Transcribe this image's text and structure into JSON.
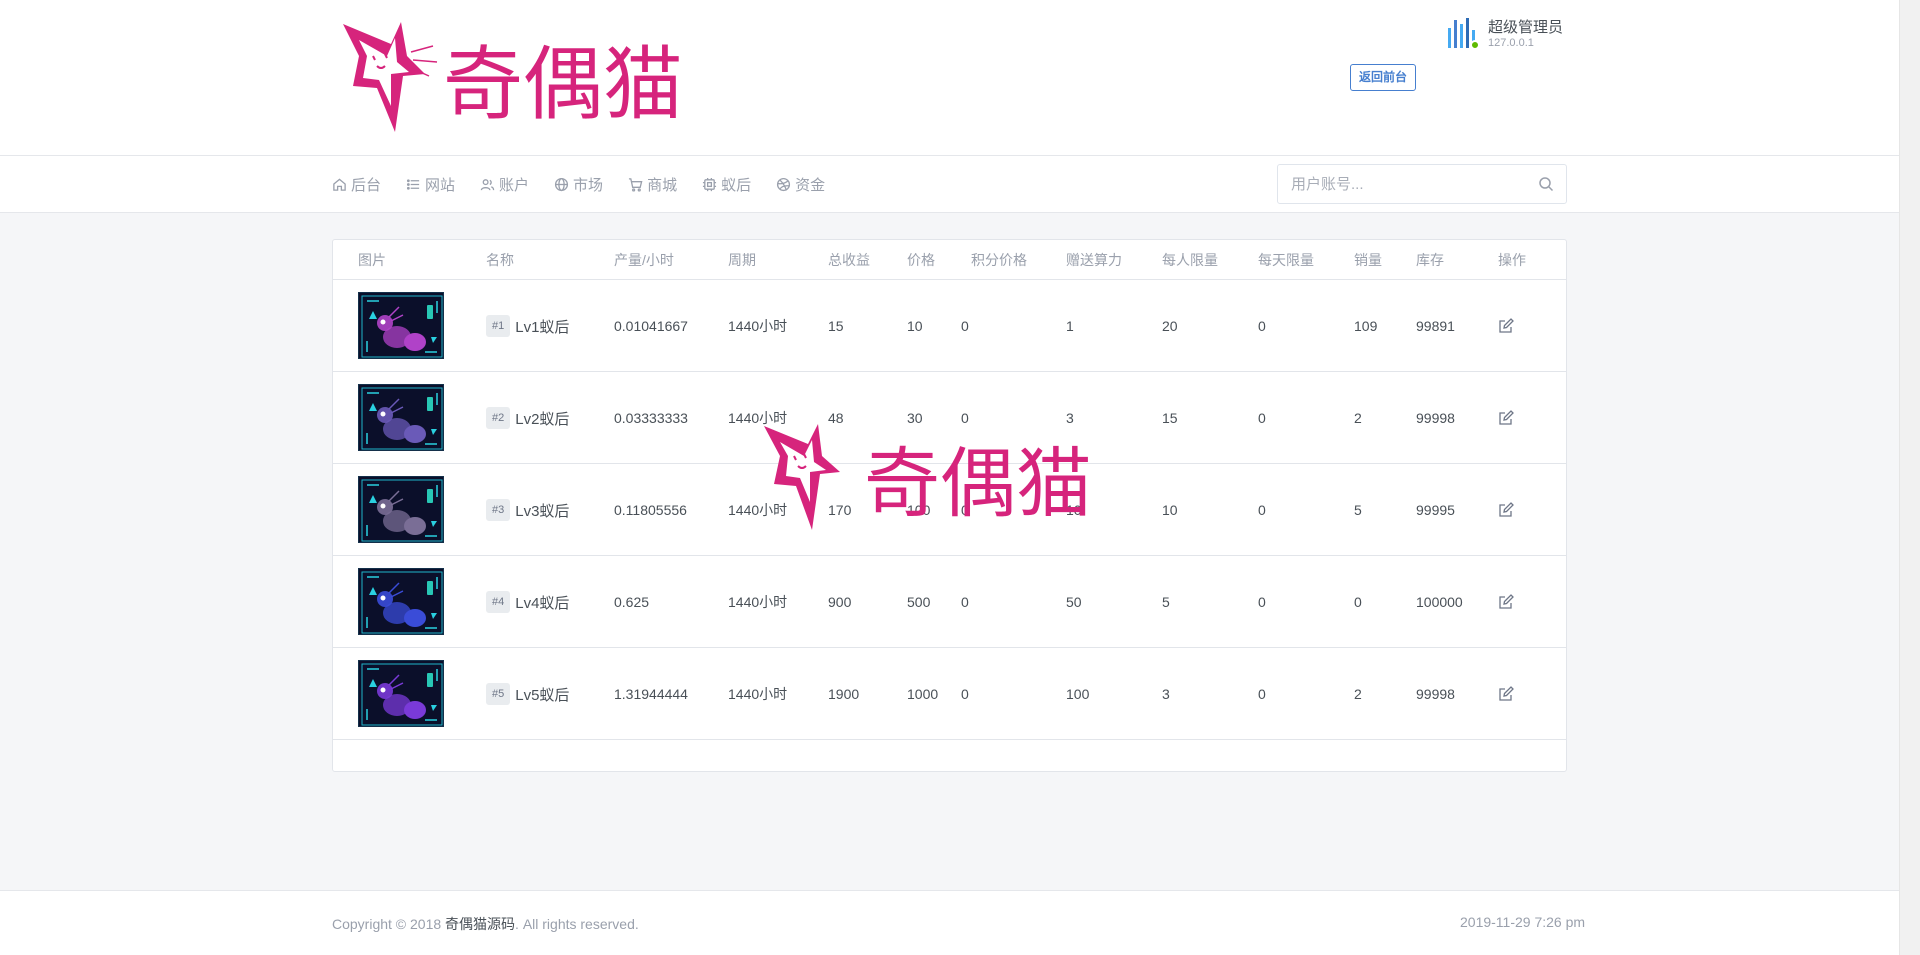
{
  "brand": {
    "logo_text": "奇偶猫",
    "primary_color": "#d6247c"
  },
  "user": {
    "name": "超级管理员",
    "ip": "127.0.0.1",
    "status_color": "#5eba00",
    "avatar_icon": "bar-chart-avatar-icon"
  },
  "header": {
    "back_button": "返回前台"
  },
  "nav": {
    "items": [
      {
        "label": "后台",
        "icon": "home-icon"
      },
      {
        "label": "网站",
        "icon": "list-icon"
      },
      {
        "label": "账户",
        "icon": "users-icon"
      },
      {
        "label": "市场",
        "icon": "globe-icon"
      },
      {
        "label": "商城",
        "icon": "cart-icon"
      },
      {
        "label": "蚁后",
        "icon": "cpu-icon"
      },
      {
        "label": "资金",
        "icon": "dribbble-icon"
      }
    ],
    "search_placeholder": "用户账号..."
  },
  "table": {
    "columns": [
      "图片",
      "名称",
      "产量/小时",
      "周期",
      "总收益",
      "价格",
      "积分价格",
      "赠送算力",
      "每人限量",
      "每天限量",
      "销量",
      "库存",
      "操作"
    ],
    "rows": [
      {
        "id": "#1",
        "name": "Lv1蚁后",
        "output": "0.01041667",
        "period": "1440小时",
        "total": "15",
        "price": "10",
        "points_price": "0",
        "bonus_power": "1",
        "per_person": "20",
        "per_day": "0",
        "sales": "109",
        "stock": "99891",
        "thumb_color": "#b042c8"
      },
      {
        "id": "#2",
        "name": "Lv2蚁后",
        "output": "0.03333333",
        "period": "1440小时",
        "total": "48",
        "price": "30",
        "points_price": "0",
        "bonus_power": "3",
        "per_person": "15",
        "per_day": "0",
        "sales": "2",
        "stock": "99998",
        "thumb_color": "#6a5ab8"
      },
      {
        "id": "#3",
        "name": "Lv3蚁后",
        "output": "0.11805556",
        "period": "1440小时",
        "total": "170",
        "price": "100",
        "points_price": "0",
        "bonus_power": "10",
        "per_person": "10",
        "per_day": "0",
        "sales": "5",
        "stock": "99995",
        "thumb_color": "#7a6e96"
      },
      {
        "id": "#4",
        "name": "Lv4蚁后",
        "output": "0.625",
        "period": "1440小时",
        "total": "900",
        "price": "500",
        "points_price": "0",
        "bonus_power": "50",
        "per_person": "5",
        "per_day": "0",
        "sales": "0",
        "stock": "100000",
        "thumb_color": "#3a4cd8"
      },
      {
        "id": "#5",
        "name": "Lv5蚁后",
        "output": "1.31944444",
        "period": "1440小时",
        "total": "1900",
        "price": "1000",
        "points_price": "0",
        "bonus_power": "100",
        "per_person": "3",
        "per_day": "0",
        "sales": "2",
        "stock": "99998",
        "thumb_color": "#7a3ad8"
      }
    ]
  },
  "footer": {
    "copyright_prefix": "Copyright © 2018 ",
    "copyright_brand": "奇偶猫源码",
    "copyright_suffix": ". All rights reserved.",
    "timestamp": "2019-11-29 7:26 pm"
  }
}
